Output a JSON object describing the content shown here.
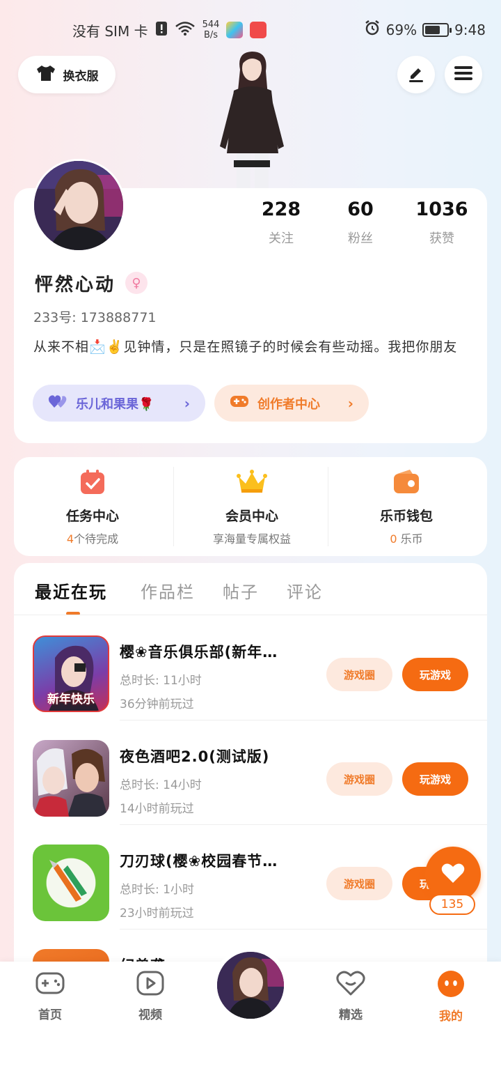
{
  "status_bar": {
    "carrier": "没有 SIM 卡",
    "net_speed_value": "544",
    "net_speed_unit": "B/s",
    "battery": "69%",
    "battery_level": 0.69,
    "time": "9:48"
  },
  "top": {
    "outfit_label": "换衣服"
  },
  "profile": {
    "name": "怦然心动",
    "gender_symbol": "♀",
    "uid": "233号: 173888771",
    "bio": "从来不相📩✌️见钟情，只是在照镜子的时候会有些动摇。我把你朋友",
    "stats": [
      {
        "value": "228",
        "label": "关注"
      },
      {
        "value": "60",
        "label": "粉丝"
      },
      {
        "value": "1036",
        "label": "获赞"
      }
    ],
    "pill_circle": "乐儿和果果🌹",
    "pill_creator": "创作者中心"
  },
  "features": [
    {
      "title": "任务中心",
      "sub_highlight": "4",
      "sub_rest": "个待完成"
    },
    {
      "title": "会员中心",
      "sub_highlight": "",
      "sub_rest": "享海量专属权益"
    },
    {
      "title": "乐币钱包",
      "sub_highlight": "0",
      "sub_rest": "乐币"
    }
  ],
  "tabs": [
    "最近在玩",
    "作品栏",
    "帖子",
    "评论"
  ],
  "games": [
    {
      "name": "樱❀音乐俱乐部(新年…",
      "total": "总时长: 11小时",
      "last": "36分钟前玩过",
      "icon_text": "新年快乐"
    },
    {
      "name": "夜色酒吧2.0(测试版)",
      "total": "总时长: 14小时",
      "last": "14小时前玩过",
      "icon_text": ""
    },
    {
      "name": "刀刃球(樱❀校园春节…",
      "total": "总时长: 1小时",
      "last": "23小时前玩过",
      "icon_text": ""
    },
    {
      "name": "幻兽袭",
      "total": "",
      "last": "",
      "icon_text": ""
    }
  ],
  "game_buttons": {
    "circle": "游戏圈",
    "play": "玩游戏"
  },
  "float_like": {
    "count": "135"
  },
  "nav": [
    {
      "label": "首页"
    },
    {
      "label": "视频"
    },
    {
      "label": "精选"
    },
    {
      "label": "我的"
    }
  ],
  "colors": {
    "accent": "#f56b12",
    "purple": "#6b66d8"
  }
}
